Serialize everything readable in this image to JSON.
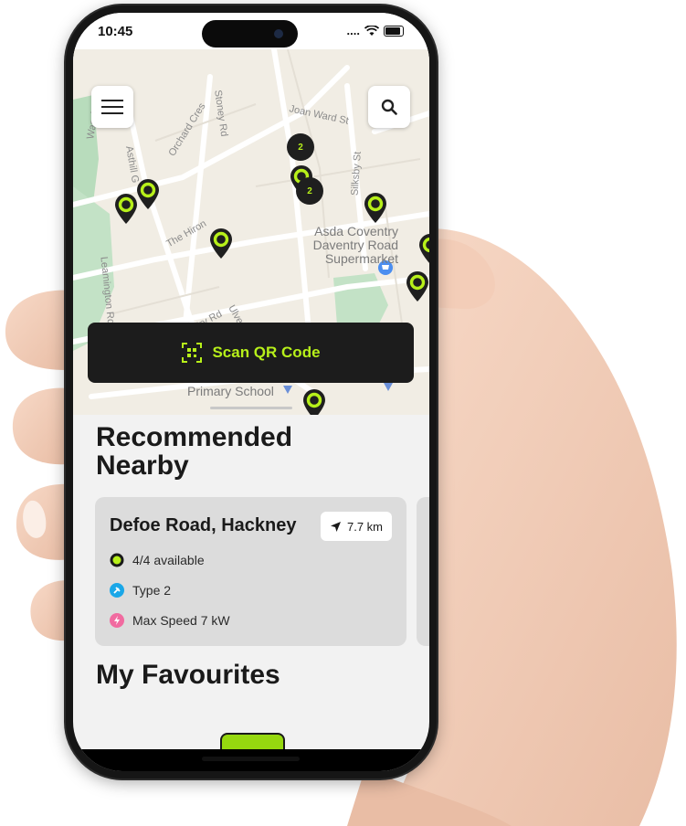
{
  "status_bar": {
    "time": "10:45",
    "signal": "....",
    "wifi_icon": "wifi-icon",
    "battery_icon": "battery-icon"
  },
  "map": {
    "labels": {
      "joan_ward": "Joan Ward St",
      "stoney": "Stoney Rd",
      "orchard": "Orchard Cres",
      "warwick": "Warwick",
      "asthill": "Asthill G",
      "silksby": "Silksby St",
      "the_hiron": "The Hiron",
      "leamington": "Leamington Rd",
      "asda": "Asda Coventry Daventry Road Supermarket",
      "primary_school": "Primary School",
      "coventry_rd": "ventry Rd",
      "ulver": "Ulver"
    },
    "clusters": [
      "2",
      "2"
    ],
    "menu_icon": "hamburger-menu-icon",
    "search_icon": "search-icon"
  },
  "scan_button": {
    "label": "Scan QR Code",
    "icon": "qr-scan-icon"
  },
  "recommended": {
    "title": "Recommended Nearby",
    "cards": [
      {
        "name": "Defoe Road, Hackney",
        "distance": "7.7 km",
        "availability": "4/4 available",
        "connector": "Type 2",
        "speed": "Max Speed 7 kW"
      }
    ]
  },
  "favourites": {
    "title": "My Favourites"
  },
  "colors": {
    "accent": "#b7f01a",
    "dark": "#1c1c1c",
    "card": "#dcdcdc",
    "connector_blue": "#1aa7e8",
    "speed_pink": "#f16ba0"
  }
}
